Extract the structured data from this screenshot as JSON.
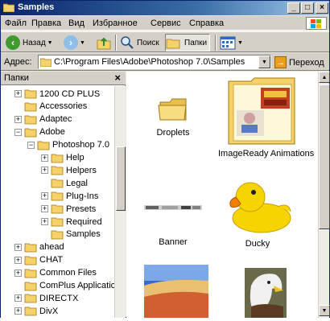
{
  "window": {
    "title": "Samples",
    "controls": {
      "minimize": "_",
      "maximize": "□",
      "close": "×"
    }
  },
  "menubar": {
    "items": [
      "Файл",
      "Правка",
      "Вид",
      "Избранное",
      "Сервис",
      "Справка"
    ]
  },
  "toolbar": {
    "back_label": "Назад",
    "search_label": "Поиск",
    "folders_label": "Папки"
  },
  "addressbar": {
    "label": "Адрес:",
    "value": "C:\\Program Files\\Adobe\\Photoshop 7.0\\Samples",
    "go_label": "Переход"
  },
  "folders_pane": {
    "title": "Папки",
    "close": "×",
    "tree": [
      {
        "label": "1200 CD PLUS",
        "level": 1,
        "expander": "+"
      },
      {
        "label": "Accessories",
        "level": 1,
        "expander": ""
      },
      {
        "label": "Adaptec",
        "level": 1,
        "expander": "+"
      },
      {
        "label": "Adobe",
        "level": 1,
        "expander": "−"
      },
      {
        "label": "Photoshop 7.0",
        "level": 2,
        "expander": "−"
      },
      {
        "label": "Help",
        "level": 3,
        "expander": "+"
      },
      {
        "label": "Helpers",
        "level": 3,
        "expander": "+"
      },
      {
        "label": "Legal",
        "level": 3,
        "expander": ""
      },
      {
        "label": "Plug-Ins",
        "level": 3,
        "expander": "+"
      },
      {
        "label": "Presets",
        "level": 3,
        "expander": "+"
      },
      {
        "label": "Required",
        "level": 3,
        "expander": "+"
      },
      {
        "label": "Samples",
        "level": 3,
        "expander": ""
      },
      {
        "label": "ahead",
        "level": 1,
        "expander": "+"
      },
      {
        "label": "CHAT",
        "level": 1,
        "expander": "+"
      },
      {
        "label": "Common Files",
        "level": 1,
        "expander": "+"
      },
      {
        "label": "ComPlus Applications",
        "level": 1,
        "expander": ""
      },
      {
        "label": "DIRECTX",
        "level": 1,
        "expander": "+"
      },
      {
        "label": "DivX",
        "level": 1,
        "expander": "+"
      }
    ]
  },
  "content": {
    "items": [
      {
        "name": "Droplets",
        "icon": "folder-icon"
      },
      {
        "name": "ImageReady Animations",
        "icon": "folder-thumbnail-icon"
      },
      {
        "name": "Banner",
        "icon": "image-thumbnail"
      },
      {
        "name": "Ducky",
        "icon": "duck-image-thumbnail"
      },
      {
        "name": "",
        "icon": "landscape-image-thumbnail"
      },
      {
        "name": "",
        "icon": "eagle-image-thumbnail"
      }
    ]
  },
  "colors": {
    "title_bar": "#0a246a",
    "face": "#d4d0c8",
    "folder": "#f5d16a",
    "duck": "#f7d300"
  }
}
